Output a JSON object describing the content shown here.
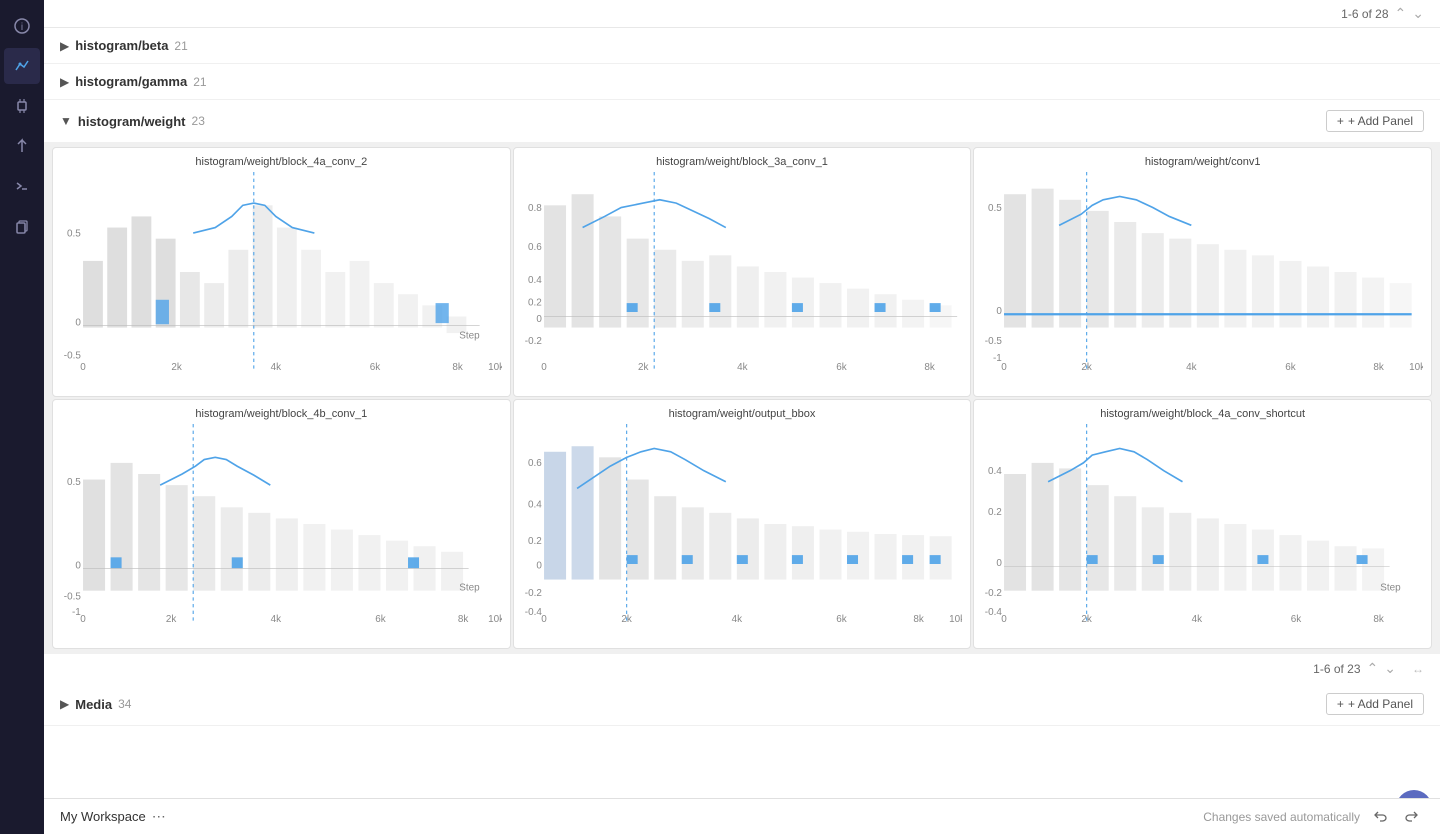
{
  "sidebar": {
    "icons": [
      {
        "name": "info-icon",
        "symbol": "ℹ",
        "active": false
      },
      {
        "name": "chart-icon",
        "symbol": "📈",
        "active": true
      },
      {
        "name": "chip-icon",
        "symbol": "⬡",
        "active": false
      },
      {
        "name": "model-icon",
        "symbol": "↑",
        "active": false
      },
      {
        "name": "terminal-icon",
        "symbol": ">_",
        "active": false
      },
      {
        "name": "copy-icon",
        "symbol": "⧉",
        "active": false
      }
    ]
  },
  "top_pagination": "1-6 of 28",
  "sections": [
    {
      "id": "beta",
      "title": "histogram/beta",
      "count": 21,
      "expanded": false
    },
    {
      "id": "gamma",
      "title": "histogram/gamma",
      "count": 21,
      "expanded": false
    },
    {
      "id": "weight",
      "title": "histogram/weight",
      "count": 23,
      "expanded": true,
      "add_panel_label": "+ Add Panel",
      "pagination": "1-6 of 23",
      "panels": [
        {
          "id": "p1",
          "title": "histogram/weight/block_4a_conv_2",
          "has_step_label": true
        },
        {
          "id": "p2",
          "title": "histogram/weight/block_3a_conv_1",
          "has_step_label": false
        },
        {
          "id": "p3",
          "title": "histogram/weight/conv1",
          "has_step_label": false
        },
        {
          "id": "p4",
          "title": "histogram/weight/block_4b_conv_1",
          "has_step_label": true
        },
        {
          "id": "p5",
          "title": "histogram/weight/output_bbox",
          "has_step_label": false
        },
        {
          "id": "p6",
          "title": "histogram/weight/block_4a_conv_shortcut",
          "has_step_label": true
        }
      ]
    }
  ],
  "media_section": {
    "title": "Media",
    "count": 34,
    "add_panel_label": "+ Add Panel"
  },
  "bottom": {
    "workspace_label": "My Workspace",
    "autosave_text": "Changes saved automatically",
    "menu_icon": "⋯"
  },
  "toolbar_icons": {
    "bookmark": "☆",
    "edit": "✏",
    "expand": "⤢",
    "more": "⋮"
  }
}
